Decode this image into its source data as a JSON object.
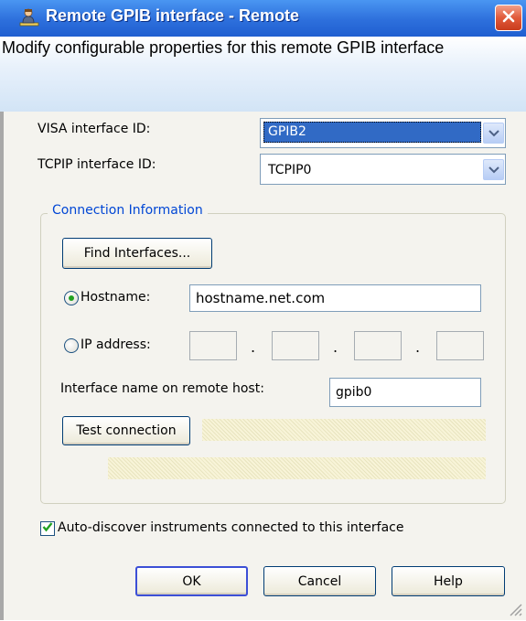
{
  "window": {
    "title": "Remote GPIB interface - Remote",
    "description": "Modify configurable properties for this remote GPIB interface"
  },
  "fields": {
    "visa_interface_label": "VISA interface ID:",
    "visa_interface_value": "GPIB2",
    "tcpip_interface_label": "TCPIP interface ID:",
    "tcpip_interface_value": "TCPIP0"
  },
  "connection": {
    "group_title": "Connection Information",
    "find_interfaces_label": "Find Interfaces...",
    "hostname_label": "Hostname:",
    "hostname_value": "hostname.net.com",
    "hostname_selected": true,
    "ip_address_label": "IP address:",
    "ip_address_selected": false,
    "ip_separator": ".",
    "remote_name_label": "Interface name on remote host:",
    "remote_name_value": "gpib0",
    "test_connection_label": "Test connection"
  },
  "options": {
    "auto_discover_label": "Auto-discover instruments connected to this interface",
    "auto_discover_checked": true
  },
  "buttons": {
    "ok": "OK",
    "cancel": "Cancel",
    "help": "Help"
  },
  "colors": {
    "titlebar": "#2d6fdc",
    "group_title": "#0046d5",
    "selection": "#316ac5",
    "close_button": "#e15a3a"
  },
  "icons": {
    "title": "user-network-icon",
    "close": "close-icon",
    "dropdown": "chevron-down-icon",
    "checkbox": "checkmark-icon",
    "resize": "resize-grip-icon"
  }
}
